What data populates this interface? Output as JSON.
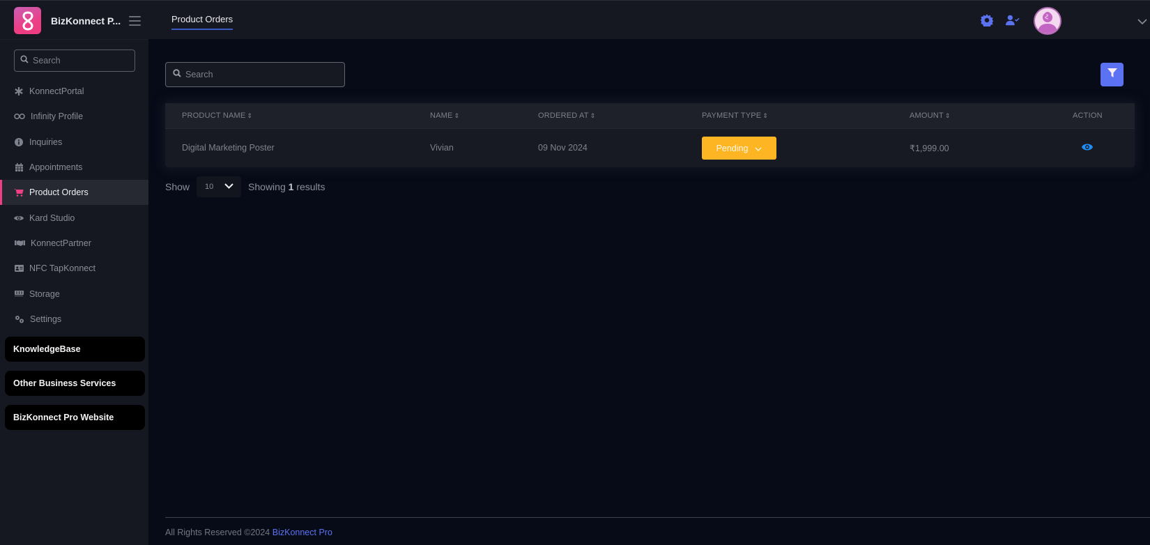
{
  "header": {
    "brand_name": "BizKonnect P...",
    "tab": "Product Orders",
    "accent": "#5b72f2"
  },
  "sidebar": {
    "search_placeholder": "Search",
    "items": [
      {
        "label": "KonnectPortal",
        "icon": "asterisk-icon",
        "active": false
      },
      {
        "label": "Infinity Profile",
        "icon": "infinity-icon",
        "active": false
      },
      {
        "label": "Inquiries",
        "icon": "info-icon",
        "active": false
      },
      {
        "label": "Appointments",
        "icon": "calendar-icon",
        "active": false
      },
      {
        "label": "Product Orders",
        "icon": "cart-icon",
        "active": true
      },
      {
        "label": "Kard Studio",
        "icon": "eye-icon",
        "active": false
      },
      {
        "label": "KonnectPartner",
        "icon": "handshake-icon",
        "active": false
      },
      {
        "label": "NFC TapKonnect",
        "icon": "id-card-icon",
        "active": false
      },
      {
        "label": "Storage",
        "icon": "memory-icon",
        "active": false
      },
      {
        "label": "Settings",
        "icon": "cogs-icon",
        "active": false
      }
    ],
    "buttons": [
      "KnowledgeBase",
      "Other Business Services",
      "BizKonnect Pro Website"
    ],
    "active_color": "#ec3f86"
  },
  "main": {
    "search_placeholder": "Search",
    "table": {
      "columns": [
        "PRODUCT NAME",
        "NAME",
        "ORDERED AT",
        "PAYMENT TYPE",
        "AMOUNT",
        "ACTION"
      ],
      "sort_icon": "⇕",
      "rows": [
        {
          "product_name": "Digital Marketing Poster",
          "name": "Vivian",
          "ordered_at": "09 Nov 2024",
          "payment_type": "Pending",
          "amount": "₹1,999.00"
        }
      ]
    },
    "pagination": {
      "show_label": "Show",
      "page_size": "10",
      "showing_prefix": "Showing",
      "showing_count": "1",
      "showing_suffix": "results"
    },
    "payment_color": "#fdb524"
  },
  "footer": {
    "text": "All Rights Reserved ©2024",
    "link": "BizKonnect Pro"
  }
}
